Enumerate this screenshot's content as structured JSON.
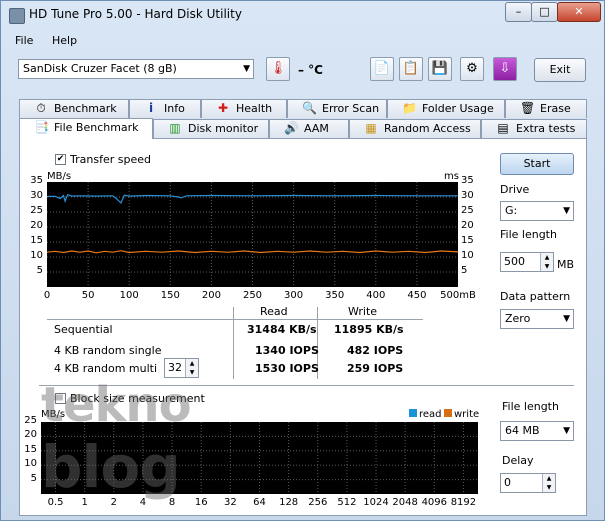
{
  "window": {
    "title": "HD Tune Pro 5.00 - Hard Disk Utility"
  },
  "caption_buttons": {
    "minimize": "–",
    "maximize": "□",
    "close": "✕"
  },
  "menu": {
    "file": "File",
    "help": "Help"
  },
  "toolbar": {
    "drive": "SanDisk Cruzer Facet      (8 gB)",
    "temperature": "– °C",
    "exit": "Exit"
  },
  "tabs_row1": [
    "Benchmark",
    "Info",
    "Health",
    "Error Scan",
    "Folder Usage",
    "Erase"
  ],
  "tabs_row2": [
    "File Benchmark",
    "Disk monitor",
    "AAM",
    "Random Access",
    "Extra tests"
  ],
  "active_tab": "File Benchmark",
  "transfer": {
    "checkbox_label": "Transfer speed",
    "checked": true,
    "y_unit_left": "MB/s",
    "y_unit_right": "ms",
    "y_ticks": [
      "35",
      "30",
      "25",
      "20",
      "15",
      "10",
      "5"
    ],
    "x_ticks": [
      "0",
      "50",
      "100",
      "150",
      "200",
      "250",
      "300",
      "350",
      "400",
      "450",
      "500mB"
    ]
  },
  "chart_data": [
    {
      "type": "line",
      "ylim": [
        0,
        35
      ],
      "xlim": [
        0,
        500
      ],
      "grid": true,
      "series": [
        {
          "name": "read",
          "color": "#2b8fd8",
          "x": [
            0,
            10,
            16,
            20,
            22,
            25,
            30,
            40,
            60,
            80,
            85,
            90,
            94,
            100,
            120,
            150,
            160,
            163,
            170,
            200,
            250,
            300,
            350,
            400,
            450,
            500
          ],
          "y": [
            30.2,
            30.2,
            29.5,
            30.5,
            28.6,
            30.8,
            30.3,
            30.4,
            30.3,
            30.4,
            29.3,
            28.0,
            30.6,
            30.3,
            30.5,
            30.4,
            30.0,
            29.7,
            30.4,
            30.5,
            30.4,
            30.5,
            30.4,
            30.5,
            30.4,
            30.4
          ]
        },
        {
          "name": "write",
          "color": "#e87818",
          "x": [
            0,
            10,
            20,
            30,
            40,
            50,
            60,
            70,
            80,
            90,
            100,
            120,
            140,
            160,
            180,
            200,
            220,
            240,
            260,
            280,
            300,
            320,
            340,
            360,
            380,
            400,
            420,
            440,
            460,
            480,
            500
          ],
          "y": [
            11.6,
            11.9,
            11.5,
            12.0,
            11.6,
            12.0,
            11.4,
            11.9,
            11.6,
            12.1,
            11.5,
            11.9,
            11.6,
            12.0,
            11.5,
            11.9,
            11.6,
            12.0,
            11.5,
            11.9,
            11.6,
            12.0,
            11.6,
            11.9,
            11.5,
            12.0,
            11.6,
            11.9,
            11.5,
            12.0,
            11.7
          ]
        }
      ]
    },
    {
      "type": "bar",
      "ylim": [
        0,
        25
      ],
      "grid": true,
      "categories": [
        "0.5",
        "1",
        "2",
        "4",
        "8",
        "16",
        "32",
        "64",
        "128",
        "256",
        "512",
        "1024",
        "2048",
        "4096",
        "8192"
      ],
      "series": [
        {
          "name": "read",
          "color": "#1a94d8",
          "values": []
        },
        {
          "name": "write",
          "color": "#d86f12",
          "values": []
        }
      ]
    }
  ],
  "results": {
    "read_header": "Read",
    "write_header": "Write",
    "rows": [
      {
        "label": "Sequential",
        "read": "31484 KB/s",
        "write": "11895 KB/s"
      },
      {
        "label": "4 KB random single",
        "read": "1340 IOPS",
        "write": "482 IOPS"
      },
      {
        "label": "4 KB random multi",
        "read": "1530 IOPS",
        "write": "259 IOPS"
      }
    ],
    "queue_depth": "32"
  },
  "right_panel": {
    "start": "Start",
    "drive_label": "Drive",
    "drive_value": "G:",
    "file_length_label": "File length",
    "file_length_value": "500",
    "file_length_unit": "MB",
    "data_pattern_label": "Data pattern",
    "data_pattern_value": "Zero"
  },
  "block": {
    "checkbox_label": "Block size measurement",
    "checked": false,
    "y_unit": "MB/s",
    "y_ticks": [
      "25",
      "20",
      "15",
      "10",
      "5"
    ],
    "legend_read": "read",
    "legend_write": "write",
    "file_length_label": "File length",
    "file_length_value": "64 MB",
    "delay_label": "Delay",
    "delay_value": "0"
  },
  "watermark": {
    "line1": "tekno",
    "line2": "blog"
  }
}
